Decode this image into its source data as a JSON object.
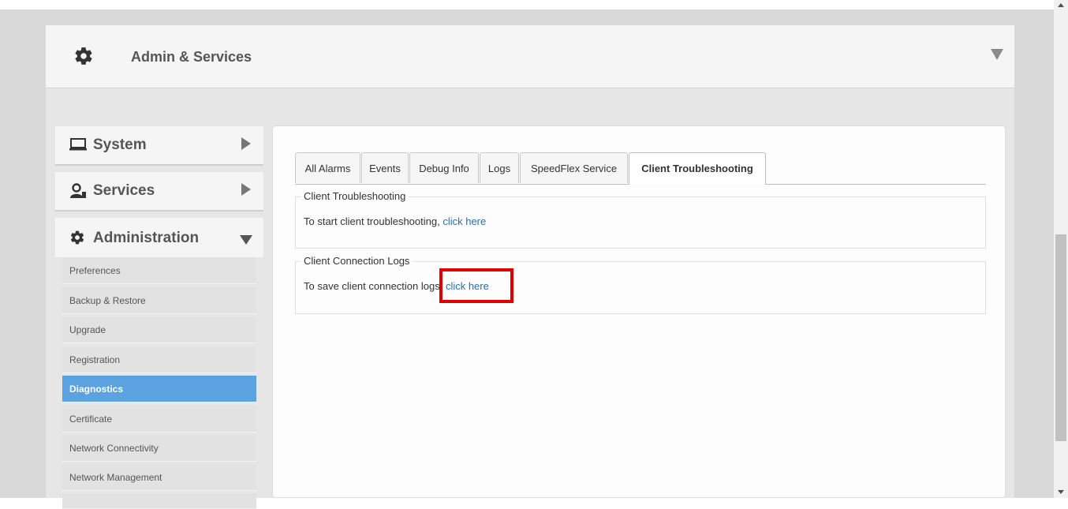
{
  "header": {
    "title": "Admin & Services",
    "icon": "gear-icon"
  },
  "sidebar": {
    "sections": [
      {
        "label": "System",
        "icon": "monitor-icon",
        "state": "collapsed"
      },
      {
        "label": "Services",
        "icon": "services-icon",
        "state": "collapsed"
      },
      {
        "label": "Administration",
        "icon": "gear-icon",
        "state": "expanded"
      }
    ],
    "items": [
      {
        "label": "Preferences"
      },
      {
        "label": "Backup & Restore"
      },
      {
        "label": "Upgrade"
      },
      {
        "label": "Registration"
      },
      {
        "label": "Diagnostics",
        "active": true
      },
      {
        "label": "Certificate"
      },
      {
        "label": "Network Connectivity"
      },
      {
        "label": "Network Management"
      }
    ]
  },
  "tabs": [
    {
      "label": "All Alarms"
    },
    {
      "label": "Events"
    },
    {
      "label": "Debug Info"
    },
    {
      "label": "Logs"
    },
    {
      "label": "SpeedFlex Service"
    },
    {
      "label": "Client Troubleshooting",
      "active": true
    }
  ],
  "troubleshooting": {
    "legend": "Client Troubleshooting",
    "text": "To start client troubleshooting, ",
    "link": "click here"
  },
  "connection_logs": {
    "legend": "Client Connection Logs",
    "text": "To save client connection logs. ",
    "link": "click here"
  },
  "colors": {
    "active_item": "#5ba3e0",
    "link": "#2a6fb0",
    "highlight": "#e00000"
  }
}
